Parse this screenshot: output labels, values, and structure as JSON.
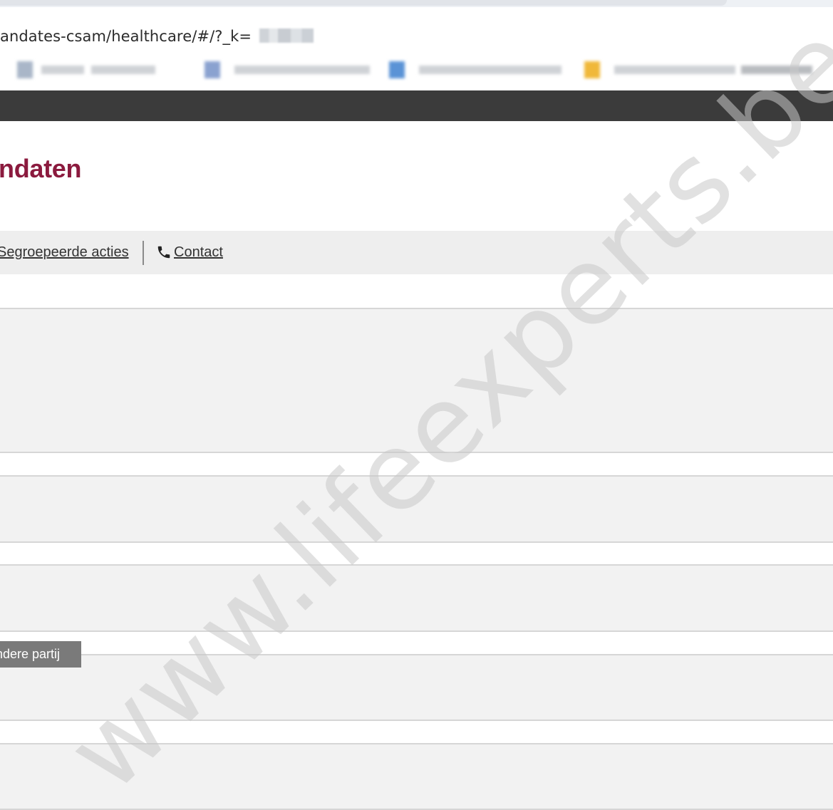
{
  "browser": {
    "url": "andates-csam/healthcare/#/?_k="
  },
  "page": {
    "title": "ndaten"
  },
  "nav": {
    "grouped_actions_label": "Segroepeerde acties",
    "contact_label": "Contact"
  },
  "content": {
    "action_button_label": "ndere partij"
  },
  "watermark": {
    "text": "www.lifeexperts.be"
  },
  "colors": {
    "title": "#8b1a3e",
    "header_bar": "#3b3b3b",
    "panel_bg": "#f2f2f2",
    "button_bg": "#7a7a7a"
  }
}
